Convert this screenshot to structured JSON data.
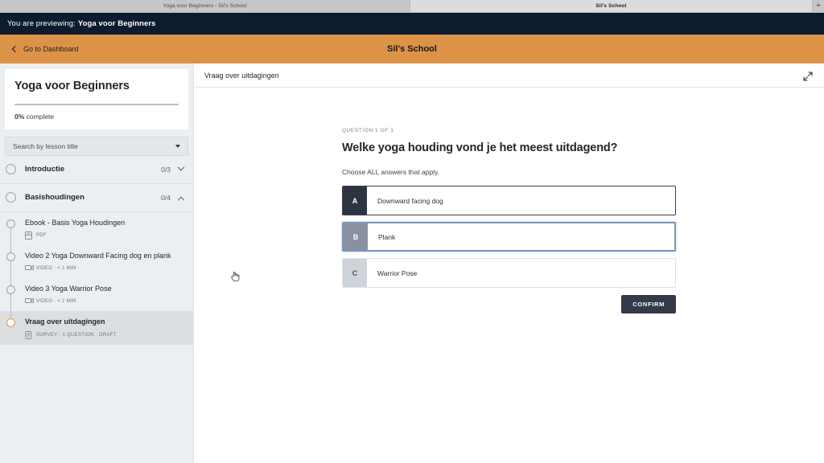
{
  "browser": {
    "tabs": [
      {
        "title": "Yoga voor Beginners - Sil's School",
        "active": false
      },
      {
        "title": "Sil's School",
        "active": true
      }
    ],
    "new_tab_label": "+"
  },
  "preview_bar": {
    "prefix": "You are previewing:",
    "course": "Yoga voor Beginners",
    "background": "#0d1b2e"
  },
  "header": {
    "dashboard_link": "Go to Dashboard",
    "school_name": "Sil's School",
    "background": "#dd9347"
  },
  "sidebar": {
    "course_title": "Yoga voor Beginners",
    "progress_percent": 0,
    "progress_text_bold": "0%",
    "progress_text_rest": " complete",
    "search_placeholder": "Search by lesson title",
    "sections": [
      {
        "label": "Introductie",
        "count": "0/3",
        "expanded": false,
        "chevron": "chevron-down-icon"
      },
      {
        "label": "Basishoudingen",
        "count": "0/4",
        "expanded": true,
        "chevron": "chevron-up-icon"
      }
    ],
    "lessons": [
      {
        "title": "Ebook - Basis Yoga Houdingen",
        "meta": "PDF",
        "icon": "pdf-icon",
        "active": false
      },
      {
        "title": "Video 2 Yoga Downward Facing dog en plank",
        "meta": "VIDEO · < 1 MIN",
        "icon": "video-icon",
        "active": false
      },
      {
        "title": "Video 3 Yoga Warrior Pose",
        "meta": "VIDEO · < 1 MIN",
        "icon": "video-icon",
        "active": false
      },
      {
        "title": "Vraag over uitdagingen",
        "meta": "SURVEY · 1 QUESTION  ·  DRAFT",
        "icon": "survey-icon",
        "active": true
      }
    ]
  },
  "main": {
    "header_title": "Vraag over uitdagingen",
    "expand_icon": "expand-icon",
    "quiz": {
      "counter": "QUESTION 1 OF 1",
      "question": "Welke yoga houding vond je het meest uitdagend?",
      "instruction": "Choose ALL answers that apply.",
      "answers": [
        {
          "letter": "A",
          "text": "Downward facing dog",
          "state": "selected-dark"
        },
        {
          "letter": "B",
          "text": "Plank",
          "state": "hovered"
        },
        {
          "letter": "C",
          "text": "Warrior Pose",
          "state": "default"
        }
      ],
      "confirm_label": "CONFIRM"
    }
  },
  "colors": {
    "accent_orange": "#dd9347",
    "dark_navy": "#0d1b2e",
    "button_dark": "#333a4a",
    "option_a_badge": "#2f3443",
    "option_b_badge": "#8990a2",
    "option_c_badge": "#cfd3da",
    "focus_blue": "#7e96bf"
  }
}
